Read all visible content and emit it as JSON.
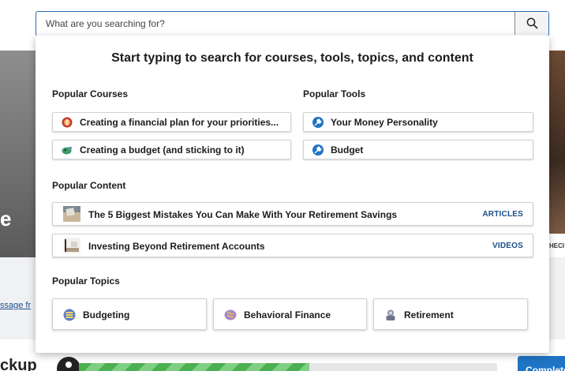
{
  "search": {
    "placeholder": "What are you searching for?",
    "button_icon": "search-icon"
  },
  "dropdown": {
    "heading": "Start typing to search for courses, tools, topics, and content",
    "popular_courses": {
      "label": "Popular Courses",
      "items": [
        {
          "label": "Creating a financial plan for your priorities...",
          "icon": "financial-plan-icon"
        },
        {
          "label": "Creating a budget (and sticking to it)",
          "icon": "budget-course-icon"
        }
      ]
    },
    "popular_tools": {
      "label": "Popular Tools",
      "items": [
        {
          "label": "Your Money Personality",
          "icon": "tool-icon"
        },
        {
          "label": "Budget",
          "icon": "tool-icon"
        }
      ]
    },
    "popular_content": {
      "label": "Popular Content",
      "items": [
        {
          "title": "The 5 Biggest Mistakes You Can Make With Your Retirement Savings",
          "type": "ARTICLES",
          "icon": "article-thumbnail"
        },
        {
          "title": "Investing Beyond Retirement Accounts",
          "type": "VIDEOS",
          "icon": "video-thumbnail"
        }
      ]
    },
    "popular_topics": {
      "label": "Popular Topics",
      "items": [
        {
          "label": "Budgeting",
          "icon": "budgeting-icon"
        },
        {
          "label": "Behavioral Finance",
          "icon": "brain-icon"
        },
        {
          "label": "Retirement",
          "icon": "retirement-icon"
        }
      ]
    }
  },
  "background": {
    "hero_letter": "e",
    "right_band_text": "HECI",
    "message_link": "ssage fr",
    "bottom_title": "ckup",
    "complete_button": "Complete",
    "progress_percent": 55
  },
  "colors": {
    "accent": "#2b6cb0",
    "link": "#1a4f8a",
    "progress_green": "#4caf50",
    "complete_button": "#1f74c4"
  }
}
